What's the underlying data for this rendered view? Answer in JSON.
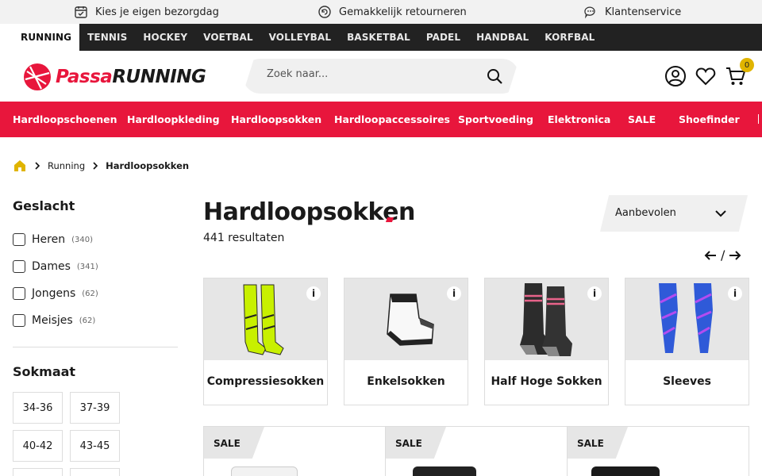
{
  "usp": [
    "Kies je eigen bezorgdag",
    "Gemakkelijk retourneren",
    "Klantenservice"
  ],
  "sports": [
    "RUNNING",
    "TENNIS",
    "HOCKEY",
    "VOETBAL",
    "VOLLEYBAL",
    "BASKETBAL",
    "PADEL",
    "HANDBAL",
    "KORFBAL"
  ],
  "logo": {
    "part1": "Passa",
    "part2": "RUNNING"
  },
  "search": {
    "placeholder": "Zoek naar..."
  },
  "cart": {
    "count": "0"
  },
  "categories": [
    "Hardloopschoenen",
    "Hardloopkleding",
    "Hardloopsokken",
    "Hardloopaccessoires",
    "Sportvoeding",
    "Elektronica",
    "SALE",
    "Shoefinder"
  ],
  "breadcrumb": [
    "Running",
    "Hardloopsokken"
  ],
  "filters": {
    "gender_title": "Geslacht",
    "gender": [
      {
        "label": "Heren",
        "count": "(340)"
      },
      {
        "label": "Dames",
        "count": "(341)"
      },
      {
        "label": "Jongens",
        "count": "(62)"
      },
      {
        "label": "Meisjes",
        "count": "(62)"
      }
    ],
    "size_title": "Sokmaat",
    "sizes": [
      "34-36",
      "37-39",
      "40-42",
      "43-45"
    ]
  },
  "main": {
    "title": "Hardloopsokken",
    "results": "441 resultaten",
    "sort": "Aanbevolen",
    "pager_sep": "/"
  },
  "subcategories": [
    {
      "label": "Compressiesokken",
      "info": "i"
    },
    {
      "label": "Enkelsokken",
      "info": "i"
    },
    {
      "label": "Half Hoge Sokken",
      "info": "i"
    },
    {
      "label": "Sleeves",
      "info": "i"
    }
  ],
  "products": [
    {
      "badge": "SALE"
    },
    {
      "badge": "SALE"
    },
    {
      "badge": "SALE"
    }
  ],
  "colors": {
    "brand": "#e8163c",
    "dark": "#222222",
    "badge": "#e0b400"
  }
}
